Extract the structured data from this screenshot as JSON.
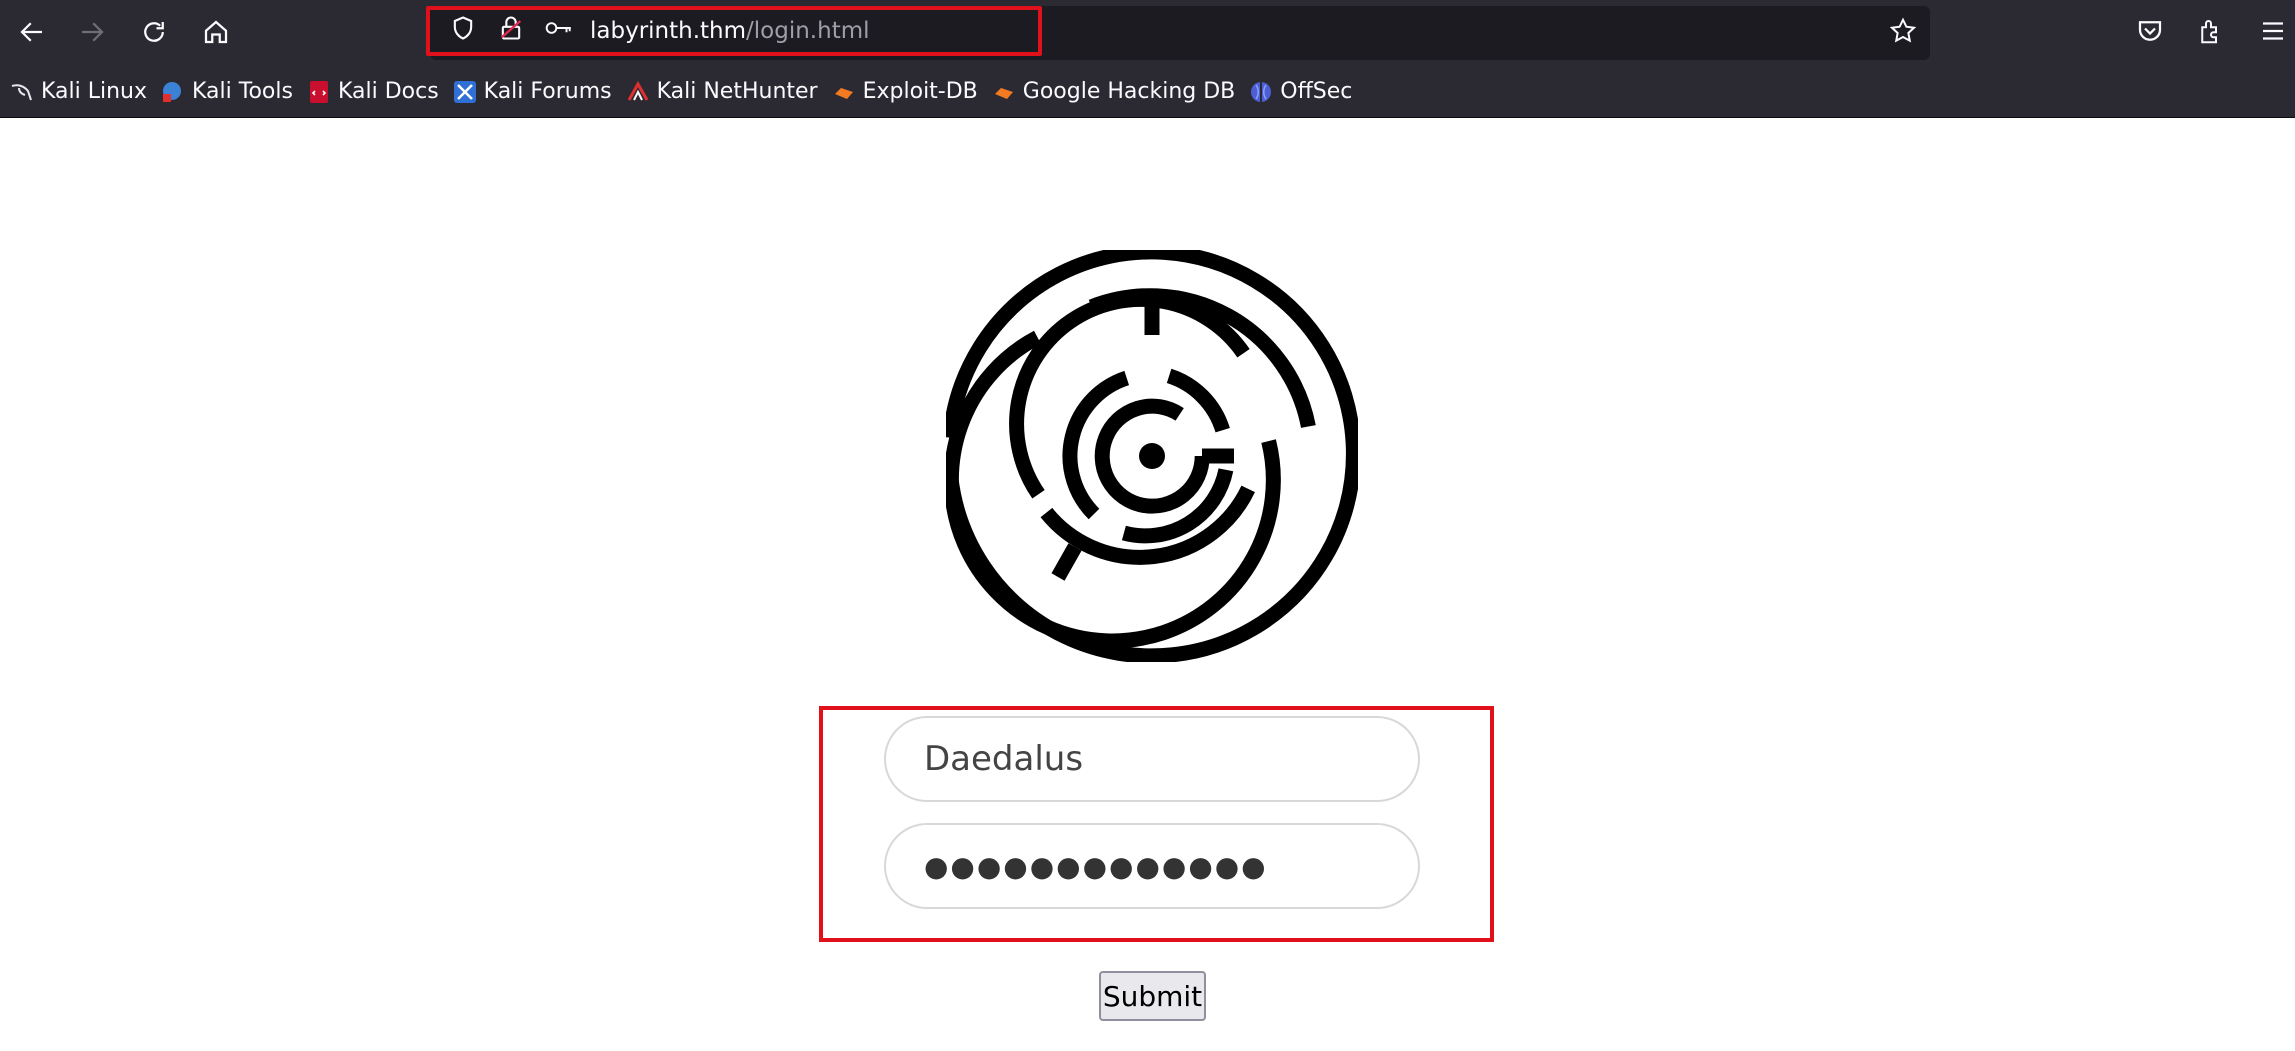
{
  "browser": {
    "url_host": "labyrinth.thm",
    "url_path": "/login.html"
  },
  "bookmarks": [
    {
      "label": "Kali Linux",
      "icon": "kali-dragon-icon"
    },
    {
      "label": "Kali Tools",
      "icon": "kali-tools-icon"
    },
    {
      "label": "Kali Docs",
      "icon": "kali-docs-icon"
    },
    {
      "label": "Kali Forums",
      "icon": "kali-forums-icon"
    },
    {
      "label": "Kali NetHunter",
      "icon": "nethunter-icon"
    },
    {
      "label": "Exploit-DB",
      "icon": "exploit-db-icon"
    },
    {
      "label": "Google Hacking DB",
      "icon": "ghdb-icon"
    },
    {
      "label": "OffSec",
      "icon": "offsec-icon"
    }
  ],
  "login": {
    "username_value": "Daedalus",
    "password_mask": "●●●●●●●●●●●●●",
    "submit_label": "Submit"
  },
  "colors": {
    "toolbar": "#2b2a33",
    "highlight": "#e0111b"
  }
}
